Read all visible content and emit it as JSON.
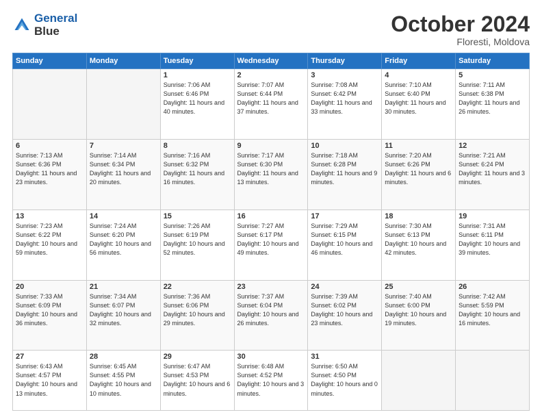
{
  "header": {
    "logo_line1": "General",
    "logo_line2": "Blue",
    "month": "October 2024",
    "location": "Floresti, Moldova"
  },
  "days_of_week": [
    "Sunday",
    "Monday",
    "Tuesday",
    "Wednesday",
    "Thursday",
    "Friday",
    "Saturday"
  ],
  "weeks": [
    [
      {
        "day": "",
        "info": ""
      },
      {
        "day": "",
        "info": ""
      },
      {
        "day": "1",
        "info": "Sunrise: 7:06 AM\nSunset: 6:46 PM\nDaylight: 11 hours and 40 minutes."
      },
      {
        "day": "2",
        "info": "Sunrise: 7:07 AM\nSunset: 6:44 PM\nDaylight: 11 hours and 37 minutes."
      },
      {
        "day": "3",
        "info": "Sunrise: 7:08 AM\nSunset: 6:42 PM\nDaylight: 11 hours and 33 minutes."
      },
      {
        "day": "4",
        "info": "Sunrise: 7:10 AM\nSunset: 6:40 PM\nDaylight: 11 hours and 30 minutes."
      },
      {
        "day": "5",
        "info": "Sunrise: 7:11 AM\nSunset: 6:38 PM\nDaylight: 11 hours and 26 minutes."
      }
    ],
    [
      {
        "day": "6",
        "info": "Sunrise: 7:13 AM\nSunset: 6:36 PM\nDaylight: 11 hours and 23 minutes."
      },
      {
        "day": "7",
        "info": "Sunrise: 7:14 AM\nSunset: 6:34 PM\nDaylight: 11 hours and 20 minutes."
      },
      {
        "day": "8",
        "info": "Sunrise: 7:16 AM\nSunset: 6:32 PM\nDaylight: 11 hours and 16 minutes."
      },
      {
        "day": "9",
        "info": "Sunrise: 7:17 AM\nSunset: 6:30 PM\nDaylight: 11 hours and 13 minutes."
      },
      {
        "day": "10",
        "info": "Sunrise: 7:18 AM\nSunset: 6:28 PM\nDaylight: 11 hours and 9 minutes."
      },
      {
        "day": "11",
        "info": "Sunrise: 7:20 AM\nSunset: 6:26 PM\nDaylight: 11 hours and 6 minutes."
      },
      {
        "day": "12",
        "info": "Sunrise: 7:21 AM\nSunset: 6:24 PM\nDaylight: 11 hours and 3 minutes."
      }
    ],
    [
      {
        "day": "13",
        "info": "Sunrise: 7:23 AM\nSunset: 6:22 PM\nDaylight: 10 hours and 59 minutes."
      },
      {
        "day": "14",
        "info": "Sunrise: 7:24 AM\nSunset: 6:20 PM\nDaylight: 10 hours and 56 minutes."
      },
      {
        "day": "15",
        "info": "Sunrise: 7:26 AM\nSunset: 6:19 PM\nDaylight: 10 hours and 52 minutes."
      },
      {
        "day": "16",
        "info": "Sunrise: 7:27 AM\nSunset: 6:17 PM\nDaylight: 10 hours and 49 minutes."
      },
      {
        "day": "17",
        "info": "Sunrise: 7:29 AM\nSunset: 6:15 PM\nDaylight: 10 hours and 46 minutes."
      },
      {
        "day": "18",
        "info": "Sunrise: 7:30 AM\nSunset: 6:13 PM\nDaylight: 10 hours and 42 minutes."
      },
      {
        "day": "19",
        "info": "Sunrise: 7:31 AM\nSunset: 6:11 PM\nDaylight: 10 hours and 39 minutes."
      }
    ],
    [
      {
        "day": "20",
        "info": "Sunrise: 7:33 AM\nSunset: 6:09 PM\nDaylight: 10 hours and 36 minutes."
      },
      {
        "day": "21",
        "info": "Sunrise: 7:34 AM\nSunset: 6:07 PM\nDaylight: 10 hours and 32 minutes."
      },
      {
        "day": "22",
        "info": "Sunrise: 7:36 AM\nSunset: 6:06 PM\nDaylight: 10 hours and 29 minutes."
      },
      {
        "day": "23",
        "info": "Sunrise: 7:37 AM\nSunset: 6:04 PM\nDaylight: 10 hours and 26 minutes."
      },
      {
        "day": "24",
        "info": "Sunrise: 7:39 AM\nSunset: 6:02 PM\nDaylight: 10 hours and 23 minutes."
      },
      {
        "day": "25",
        "info": "Sunrise: 7:40 AM\nSunset: 6:00 PM\nDaylight: 10 hours and 19 minutes."
      },
      {
        "day": "26",
        "info": "Sunrise: 7:42 AM\nSunset: 5:59 PM\nDaylight: 10 hours and 16 minutes."
      }
    ],
    [
      {
        "day": "27",
        "info": "Sunrise: 6:43 AM\nSunset: 4:57 PM\nDaylight: 10 hours and 13 minutes."
      },
      {
        "day": "28",
        "info": "Sunrise: 6:45 AM\nSunset: 4:55 PM\nDaylight: 10 hours and 10 minutes."
      },
      {
        "day": "29",
        "info": "Sunrise: 6:47 AM\nSunset: 4:53 PM\nDaylight: 10 hours and 6 minutes."
      },
      {
        "day": "30",
        "info": "Sunrise: 6:48 AM\nSunset: 4:52 PM\nDaylight: 10 hours and 3 minutes."
      },
      {
        "day": "31",
        "info": "Sunrise: 6:50 AM\nSunset: 4:50 PM\nDaylight: 10 hours and 0 minutes."
      },
      {
        "day": "",
        "info": ""
      },
      {
        "day": "",
        "info": ""
      }
    ]
  ]
}
